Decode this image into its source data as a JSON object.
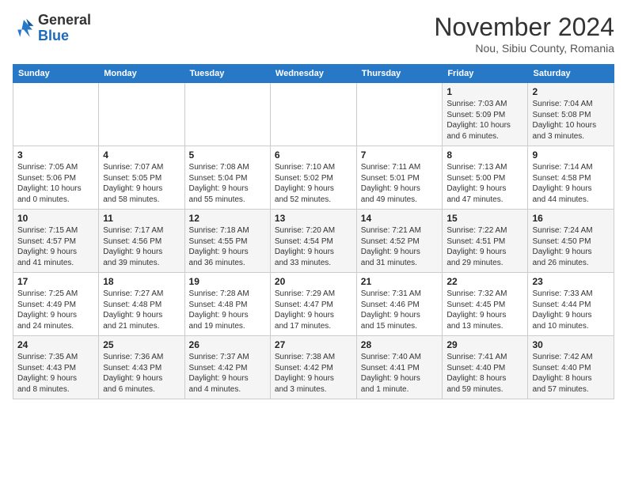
{
  "header": {
    "logo_general": "General",
    "logo_blue": "Blue",
    "month_title": "November 2024",
    "location": "Nou, Sibiu County, Romania"
  },
  "weekdays": [
    "Sunday",
    "Monday",
    "Tuesday",
    "Wednesday",
    "Thursday",
    "Friday",
    "Saturday"
  ],
  "weeks": [
    [
      {
        "day": "",
        "info": ""
      },
      {
        "day": "",
        "info": ""
      },
      {
        "day": "",
        "info": ""
      },
      {
        "day": "",
        "info": ""
      },
      {
        "day": "",
        "info": ""
      },
      {
        "day": "1",
        "info": "Sunrise: 7:03 AM\nSunset: 5:09 PM\nDaylight: 10 hours\nand 6 minutes."
      },
      {
        "day": "2",
        "info": "Sunrise: 7:04 AM\nSunset: 5:08 PM\nDaylight: 10 hours\nand 3 minutes."
      }
    ],
    [
      {
        "day": "3",
        "info": "Sunrise: 7:05 AM\nSunset: 5:06 PM\nDaylight: 10 hours\nand 0 minutes."
      },
      {
        "day": "4",
        "info": "Sunrise: 7:07 AM\nSunset: 5:05 PM\nDaylight: 9 hours\nand 58 minutes."
      },
      {
        "day": "5",
        "info": "Sunrise: 7:08 AM\nSunset: 5:04 PM\nDaylight: 9 hours\nand 55 minutes."
      },
      {
        "day": "6",
        "info": "Sunrise: 7:10 AM\nSunset: 5:02 PM\nDaylight: 9 hours\nand 52 minutes."
      },
      {
        "day": "7",
        "info": "Sunrise: 7:11 AM\nSunset: 5:01 PM\nDaylight: 9 hours\nand 49 minutes."
      },
      {
        "day": "8",
        "info": "Sunrise: 7:13 AM\nSunset: 5:00 PM\nDaylight: 9 hours\nand 47 minutes."
      },
      {
        "day": "9",
        "info": "Sunrise: 7:14 AM\nSunset: 4:58 PM\nDaylight: 9 hours\nand 44 minutes."
      }
    ],
    [
      {
        "day": "10",
        "info": "Sunrise: 7:15 AM\nSunset: 4:57 PM\nDaylight: 9 hours\nand 41 minutes."
      },
      {
        "day": "11",
        "info": "Sunrise: 7:17 AM\nSunset: 4:56 PM\nDaylight: 9 hours\nand 39 minutes."
      },
      {
        "day": "12",
        "info": "Sunrise: 7:18 AM\nSunset: 4:55 PM\nDaylight: 9 hours\nand 36 minutes."
      },
      {
        "day": "13",
        "info": "Sunrise: 7:20 AM\nSunset: 4:54 PM\nDaylight: 9 hours\nand 33 minutes."
      },
      {
        "day": "14",
        "info": "Sunrise: 7:21 AM\nSunset: 4:52 PM\nDaylight: 9 hours\nand 31 minutes."
      },
      {
        "day": "15",
        "info": "Sunrise: 7:22 AM\nSunset: 4:51 PM\nDaylight: 9 hours\nand 29 minutes."
      },
      {
        "day": "16",
        "info": "Sunrise: 7:24 AM\nSunset: 4:50 PM\nDaylight: 9 hours\nand 26 minutes."
      }
    ],
    [
      {
        "day": "17",
        "info": "Sunrise: 7:25 AM\nSunset: 4:49 PM\nDaylight: 9 hours\nand 24 minutes."
      },
      {
        "day": "18",
        "info": "Sunrise: 7:27 AM\nSunset: 4:48 PM\nDaylight: 9 hours\nand 21 minutes."
      },
      {
        "day": "19",
        "info": "Sunrise: 7:28 AM\nSunset: 4:48 PM\nDaylight: 9 hours\nand 19 minutes."
      },
      {
        "day": "20",
        "info": "Sunrise: 7:29 AM\nSunset: 4:47 PM\nDaylight: 9 hours\nand 17 minutes."
      },
      {
        "day": "21",
        "info": "Sunrise: 7:31 AM\nSunset: 4:46 PM\nDaylight: 9 hours\nand 15 minutes."
      },
      {
        "day": "22",
        "info": "Sunrise: 7:32 AM\nSunset: 4:45 PM\nDaylight: 9 hours\nand 13 minutes."
      },
      {
        "day": "23",
        "info": "Sunrise: 7:33 AM\nSunset: 4:44 PM\nDaylight: 9 hours\nand 10 minutes."
      }
    ],
    [
      {
        "day": "24",
        "info": "Sunrise: 7:35 AM\nSunset: 4:43 PM\nDaylight: 9 hours\nand 8 minutes."
      },
      {
        "day": "25",
        "info": "Sunrise: 7:36 AM\nSunset: 4:43 PM\nDaylight: 9 hours\nand 6 minutes."
      },
      {
        "day": "26",
        "info": "Sunrise: 7:37 AM\nSunset: 4:42 PM\nDaylight: 9 hours\nand 4 minutes."
      },
      {
        "day": "27",
        "info": "Sunrise: 7:38 AM\nSunset: 4:42 PM\nDaylight: 9 hours\nand 3 minutes."
      },
      {
        "day": "28",
        "info": "Sunrise: 7:40 AM\nSunset: 4:41 PM\nDaylight: 9 hours\nand 1 minute."
      },
      {
        "day": "29",
        "info": "Sunrise: 7:41 AM\nSunset: 4:40 PM\nDaylight: 8 hours\nand 59 minutes."
      },
      {
        "day": "30",
        "info": "Sunrise: 7:42 AM\nSunset: 4:40 PM\nDaylight: 8 hours\nand 57 minutes."
      }
    ]
  ]
}
